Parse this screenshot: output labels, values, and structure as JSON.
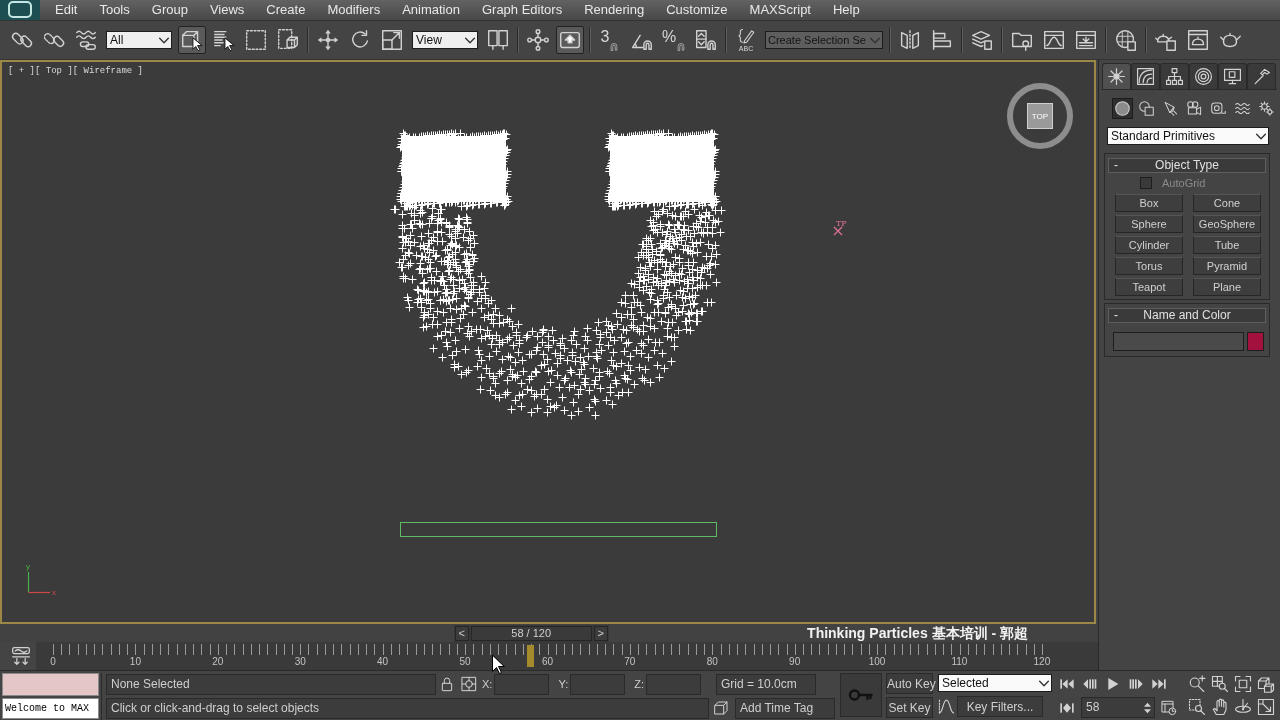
{
  "menu_bar": {
    "items": [
      "Edit",
      "Tools",
      "Group",
      "Views",
      "Create",
      "Modifiers",
      "Animation",
      "Graph Editors",
      "Rendering",
      "Customize",
      "MAXScript",
      "Help"
    ]
  },
  "main_toolbar": [
    {
      "kind": "button",
      "pressed": false
    },
    {
      "kind": "button",
      "pressed": false
    },
    {
      "kind": "button",
      "pressed": false
    },
    {
      "kind": "dropdown",
      "value": "All"
    },
    {
      "kind": "button",
      "pressed": true
    },
    {
      "kind": "button",
      "pressed": false
    },
    {
      "kind": "button",
      "pressed": false
    },
    {
      "kind": "button",
      "pressed": false
    },
    {
      "kind": "separator"
    },
    {
      "kind": "button",
      "pressed": false
    },
    {
      "kind": "button",
      "pressed": false
    },
    {
      "kind": "button",
      "pressed": false
    },
    {
      "kind": "dropdown",
      "value": "View"
    },
    {
      "kind": "button",
      "pressed": false
    },
    {
      "kind": "separator"
    },
    {
      "kind": "button",
      "pressed": false
    },
    {
      "kind": "button",
      "pressed": true
    },
    {
      "kind": "separator"
    },
    {
      "kind": "glyph_button",
      "glyph": "3",
      "pressed": false
    },
    {
      "kind": "button",
      "pressed": false
    },
    {
      "kind": "glyph_button",
      "glyph": "%",
      "pressed": false
    },
    {
      "kind": "button",
      "pressed": false
    },
    {
      "kind": "separator"
    },
    {
      "kind": "caption_button",
      "caption": "ABC",
      "pressed": false
    },
    {
      "kind": "combo",
      "value": "Create Selection Se"
    },
    {
      "kind": "separator"
    },
    {
      "kind": "button",
      "pressed": false
    },
    {
      "kind": "button",
      "pressed": false
    },
    {
      "kind": "separator"
    },
    {
      "kind": "button",
      "pressed": false
    },
    {
      "kind": "separator"
    },
    {
      "kind": "button",
      "pressed": false
    },
    {
      "kind": "button",
      "pressed": false
    },
    {
      "kind": "button",
      "pressed": false
    },
    {
      "kind": "separator"
    },
    {
      "kind": "button",
      "pressed": false
    },
    {
      "kind": "separator"
    },
    {
      "kind": "button",
      "pressed": false
    },
    {
      "kind": "button",
      "pressed": false
    },
    {
      "kind": "button",
      "pressed": false
    }
  ],
  "viewport": {
    "label": "[ + ][ Top ][ Wireframe ]",
    "active": true,
    "view_cube": {
      "label": "TOP"
    },
    "helper_label": "TP",
    "axis": {
      "x_label": "x",
      "y_label": "y"
    }
  },
  "command_panel": {
    "tabs": [
      {
        "selected": true
      },
      {
        "selected": false
      },
      {
        "selected": false
      },
      {
        "selected": false
      },
      {
        "selected": false
      },
      {
        "selected": false
      }
    ],
    "categories": [
      {
        "selected": true
      },
      {
        "selected": false
      },
      {
        "selected": false
      },
      {
        "selected": false
      },
      {
        "selected": false
      },
      {
        "selected": false
      },
      {
        "selected": false
      }
    ],
    "category_dropdown": {
      "value": "Standard Primitives"
    },
    "rollouts": [
      {
        "kind": "object_type",
        "collapse": "-",
        "title": "Object Type",
        "autogrid": {
          "label": "AutoGrid",
          "checked": false
        },
        "buttons": [
          "Box",
          "Cone",
          "Sphere",
          "GeoSphere",
          "Cylinder",
          "Tube",
          "Torus",
          "Pyramid",
          "Teapot",
          "Plane"
        ]
      },
      {
        "kind": "name_and_color",
        "collapse": "-",
        "title": "Name and Color",
        "color": "#a3123f"
      }
    ]
  },
  "time_slider": {
    "previous": "<",
    "position": "58 / 120",
    "next": ">",
    "level": 0.483
  },
  "video_caption": "Thinking Particles 基本培训 - 郭超",
  "track_bar": {
    "labels": [
      "0",
      "10",
      "20",
      "30",
      "40",
      "50",
      "60",
      "70",
      "80",
      "90",
      "100",
      "110",
      "120"
    ]
  },
  "status_bar": {
    "listener": {
      "output": "Welcome to MAX"
    },
    "selection": "None Selected",
    "prompt": "Click or click-and-drag to select objects",
    "coordinates": [
      {
        "label": "X:"
      },
      {
        "label": "Y:"
      },
      {
        "label": "Z:"
      }
    ],
    "grid": "Grid = 10.0cm",
    "time_tag": "Add Time Tag",
    "auto_key": {
      "label": "Auto Key",
      "on": false
    },
    "set_key": {
      "label": "Set Key"
    },
    "key_set": {
      "value": "Selected"
    },
    "key_filters": {
      "label": "Key Filters..."
    },
    "frame": {
      "value": "58"
    }
  }
}
